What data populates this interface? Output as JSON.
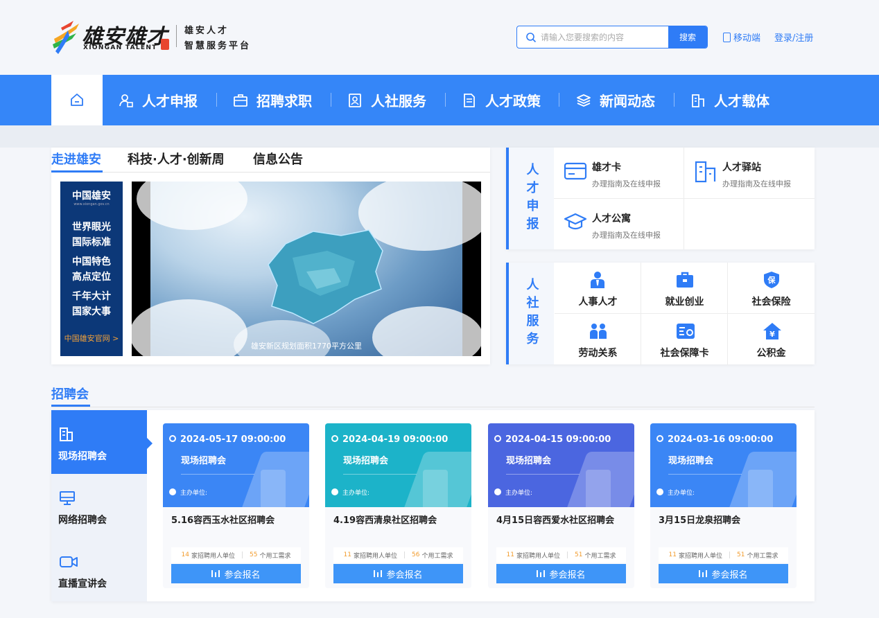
{
  "header": {
    "logo_title": "雄安雄才",
    "logo_en": "XIONGAN TALENT",
    "logo_sub": [
      "雄安人才",
      "智慧服务平台"
    ],
    "search_placeholder": "请输入您要搜索的内容",
    "search_button": "搜索",
    "mobile_link": "移动端",
    "login_link": "登录/注册"
  },
  "nav": {
    "items": [
      {
        "label": "人才申报",
        "icon": "talent-apply-icon"
      },
      {
        "label": "招聘求职",
        "icon": "briefcase-icon"
      },
      {
        "label": "人社服务",
        "icon": "person-card-icon"
      },
      {
        "label": "人才政策",
        "icon": "document-icon"
      },
      {
        "label": "新闻动态",
        "icon": "layers-icon"
      },
      {
        "label": "人才载体",
        "icon": "building-icon"
      }
    ],
    "colors": {
      "bar": "#3586f8",
      "active_bg": "#ffffff"
    }
  },
  "intro": {
    "tabs": [
      "走进雄安",
      "科技·人才·创新周",
      "信息公告"
    ],
    "active_tab": 0,
    "banner": {
      "title": "中国雄安",
      "url": "www.xiongan.gov.cn",
      "lines": [
        "世界眼光",
        "国际标准",
        "中国特色",
        "高点定位",
        "千年大计",
        "国家大事"
      ],
      "link": "中国雄安官网 >"
    },
    "video_caption": "雄安新区规划面积1770平方公里"
  },
  "talent_apply": {
    "label": "人才申报",
    "items": [
      {
        "title": "雄才卡",
        "sub": "办理指南及在线申报",
        "icon": "card-icon"
      },
      {
        "title": "人才驿站",
        "sub": "办理指南及在线申报",
        "icon": "building-icon"
      },
      {
        "title": "人才公寓",
        "sub": "办理指南及在线申报",
        "icon": "graduation-cap-icon"
      }
    ]
  },
  "hr_services": {
    "label": "人社服务",
    "items": [
      {
        "title": "人事人才",
        "icon": "person-tie-icon"
      },
      {
        "title": "就业创业",
        "icon": "briefcase-icon"
      },
      {
        "title": "社会保险",
        "icon": "shield-icon"
      },
      {
        "title": "劳动关系",
        "icon": "people-icon"
      },
      {
        "title": "社会保障卡",
        "icon": "id-card-icon"
      },
      {
        "title": "公积金",
        "icon": "house-yuan-icon"
      }
    ]
  },
  "job_fair": {
    "title": "招聘会",
    "tabs": [
      {
        "label": "现场招聘会",
        "icon": "building-icon"
      },
      {
        "label": "网络招聘会",
        "icon": "monitor-icon"
      },
      {
        "label": "直播宣讲会",
        "icon": "video-camera-icon"
      }
    ],
    "active_tab": 0,
    "cards": [
      {
        "date": "2024-05-17 09:00:00",
        "type": "现场招聘会",
        "host": "主办单位:",
        "name": "5.16容西玉水社区招聘会",
        "units": "14",
        "units_label": "家招聘用人单位",
        "demand": "55",
        "demand_label": "个用工需求",
        "button": "参会报名",
        "color": "#3b86f5"
      },
      {
        "date": "2024-04-19 09:00:00",
        "type": "现场招聘会",
        "host": "主办单位:",
        "name": "4.19容西清泉社区招聘会",
        "units": "11",
        "units_label": "家招聘用人单位",
        "demand": "56",
        "demand_label": "个用工需求",
        "button": "参会报名",
        "color": "#1cb3c9"
      },
      {
        "date": "2024-04-15 09:00:00",
        "type": "现场招聘会",
        "host": "主办单位:",
        "name": "4月15日容西爱水社区招聘会",
        "units": "11",
        "units_label": "家招聘用人单位",
        "demand": "51",
        "demand_label": "个用工需求",
        "button": "参会报名",
        "color": "#4b66e0"
      },
      {
        "date": "2024-03-16 09:00:00",
        "type": "现场招聘会",
        "host": "主办单位:",
        "name": "3月15日龙泉招聘会",
        "units": "11",
        "units_label": "家招聘用人单位",
        "demand": "51",
        "demand_label": "个用工需求",
        "button": "参会报名",
        "color": "#3b86f5"
      }
    ]
  }
}
